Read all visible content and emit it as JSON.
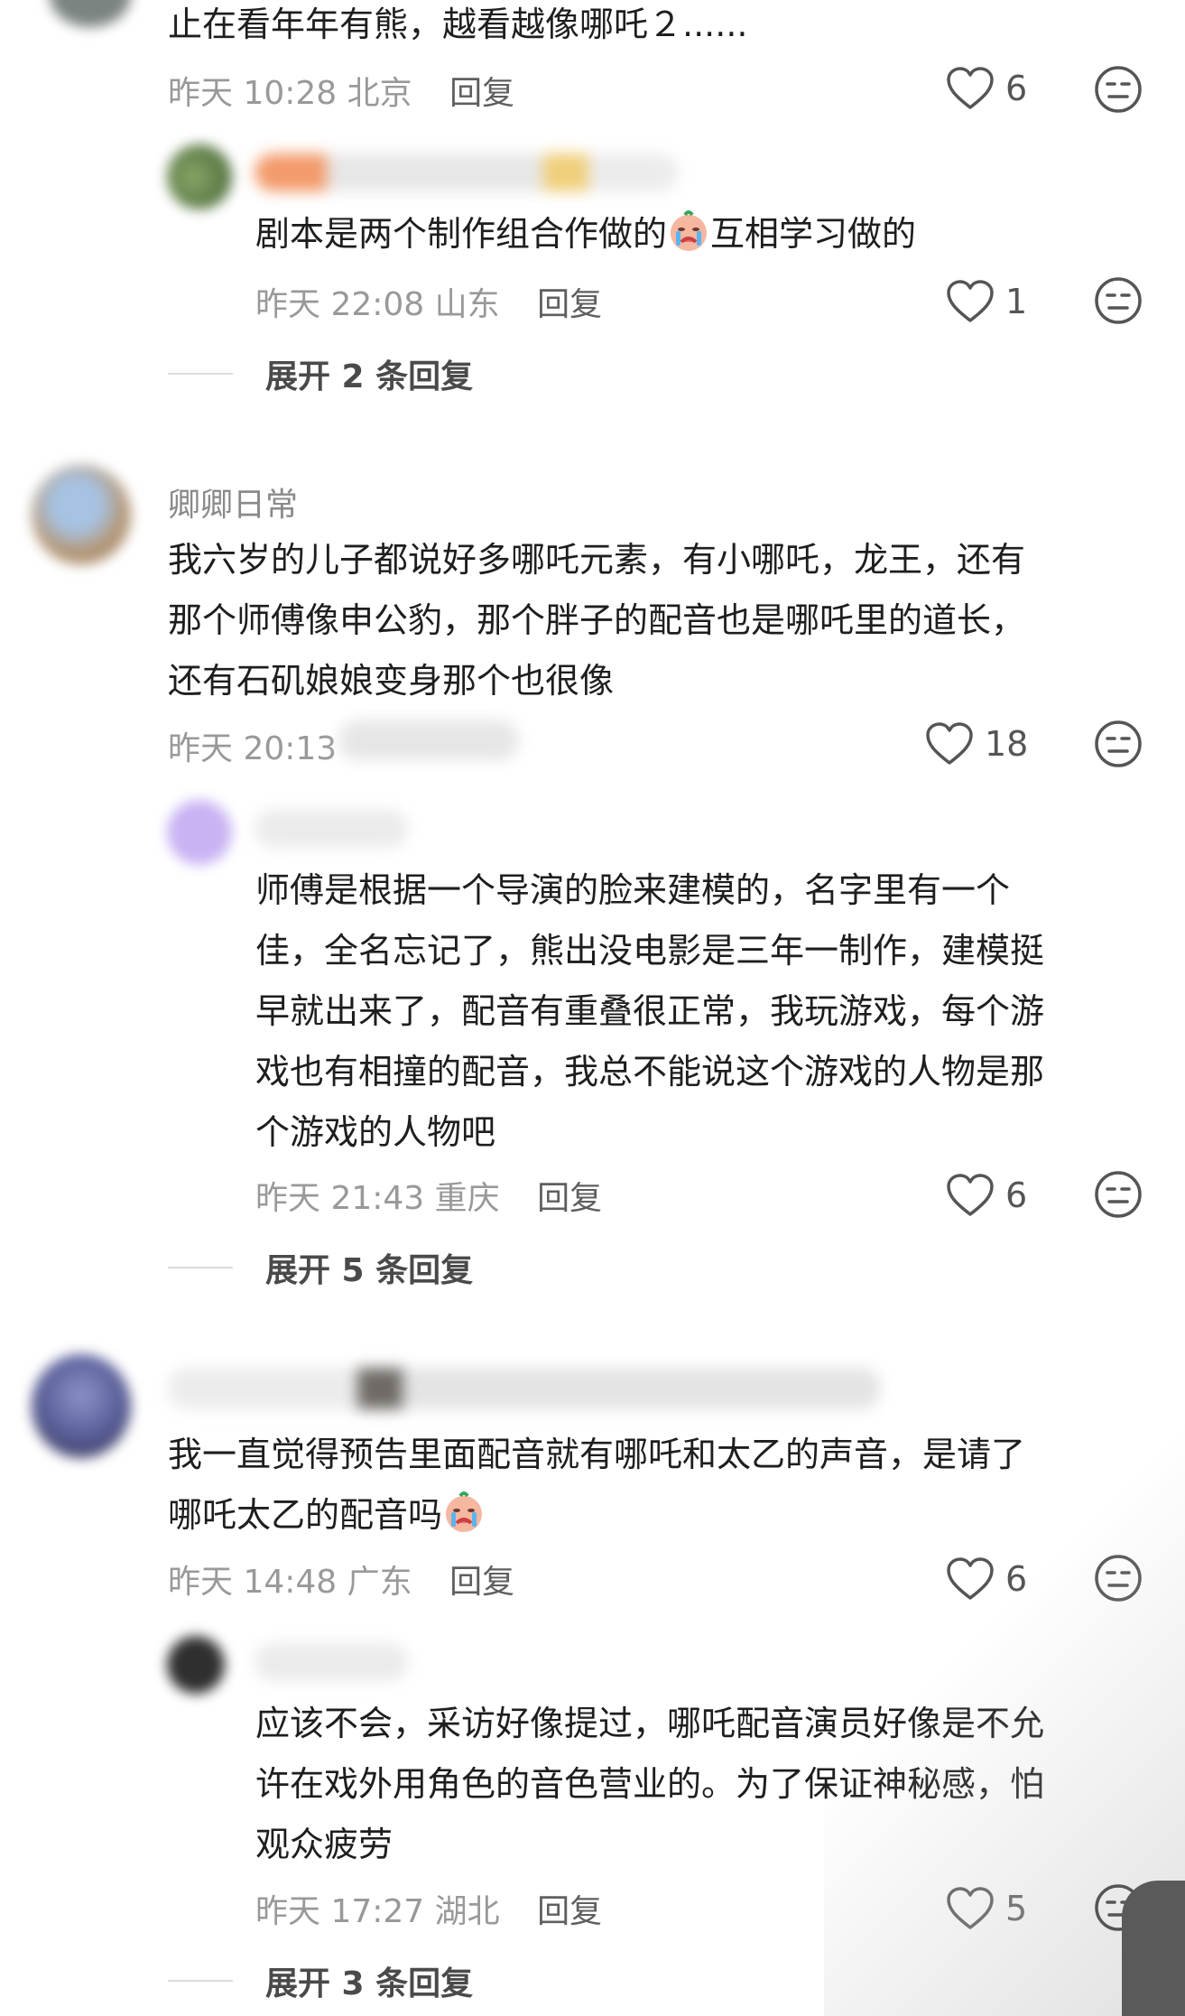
{
  "comments": [
    {
      "text_lines": [
        "止在看年年有熊，越看越像哪吒２......"
      ],
      "time": "昨天 10:28 北京",
      "reply_label": "回复",
      "likes": "6"
    },
    {
      "text_lines": [
        "剧本是两个制作组合作做的",
        "互相学习做的"
      ],
      "time": "昨天 22:08 山东",
      "reply_label": "回复",
      "likes": "1",
      "expand": "展开 2 条回复"
    },
    {
      "name": "卿卿日常",
      "text_lines": [
        "我六岁的儿子都说好多哪吒元素，有小哪吒，龙王，还有",
        "那个师傅像申公豹，那个胖子的配音也是哪吒里的道长，",
        "还有石矶娘娘变身那个也很像"
      ],
      "time": "昨天 20:13",
      "likes": "18"
    },
    {
      "text_lines": [
        "师傅是根据一个导演的脸来建模的，名字里有一个",
        "佳，全名忘记了，熊出没电影是三年一制作，建模挺",
        "早就出来了，配音有重叠很正常，我玩游戏，每个游",
        "戏也有相撞的配音，我总不能说这个游戏的人物是那",
        "个游戏的人物吧"
      ],
      "time": "昨天 21:43 重庆",
      "reply_label": "回复",
      "likes": "6",
      "expand": "展开 5 条回复"
    },
    {
      "text_lines": [
        "我一直觉得预告里面配音就有哪吒和太乙的声音，是请了",
        "哪吒太乙的配音吗"
      ],
      "time": "昨天 14:48 广东",
      "reply_label": "回复",
      "likes": "6"
    },
    {
      "text_lines": [
        "应该不会，采访好像提过，哪吒配音演员好像是不允",
        "许在戏外用角色的音色营业的。为了保证神秘感，怕",
        "观众疲劳"
      ],
      "time": "昨天 17:27 湖北",
      "reply_label": "回复",
      "likes": "5",
      "expand": "展开 3 条回复"
    }
  ],
  "icons": {
    "like": "heart-outline-icon",
    "emoji": "neutral-face-icon",
    "inline_emoji": "crying-face-emoji"
  },
  "colors": {
    "text": "#1e1e1e",
    "meta": "#999999",
    "name": "#8a8a8a"
  }
}
